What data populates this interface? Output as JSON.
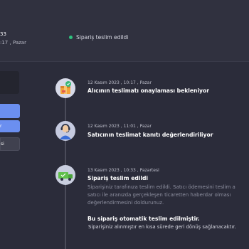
{
  "header": {
    "order_date": "33",
    "order_time": ":17 , Pazar",
    "status_text": "Sipariş teslim edildi",
    "status_color": "#2ec27e"
  },
  "left_panel": {
    "buttons": [
      {
        "label": ""
      },
      {
        "label": "r"
      },
      {
        "label": "si"
      }
    ]
  },
  "timeline": {
    "events": [
      {
        "icon": "package-warning-icon",
        "date": "12 Kasım 2023 , 10:17 , Pazar",
        "title": "Alıcının teslimatı onaylaması bekleniyor"
      },
      {
        "icon": "support-agent-icon",
        "date": "12 Kasım 2023 , 11:01 , Pazar",
        "title": "Satıcının teslimat kanıtı değerlendiriliyor"
      },
      {
        "icon": "delivery-truck-icon",
        "date": "13 Kasım 2023 , 10:33 , Pazartesi",
        "title": "Sipariş teslim edildi",
        "description_lines": [
          "Siparişiniz tarafınıza teslim edildi. Satıcı ödemesini teslim a",
          "satıcı ile aranızda gerçekleşen ticaretten haberdar olması",
          "değerlendirmesini doldurunuz."
        ],
        "subtitle": "Bu sipariş otomatik teslim edilmiştir.",
        "note": "Siparişiniz alınmıştır en kısa sürede geri dönüş sağlanacaktır."
      }
    ]
  }
}
